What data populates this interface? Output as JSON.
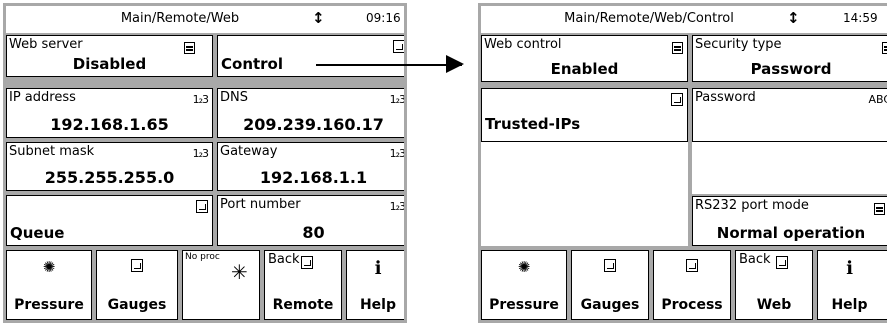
{
  "left_screen": {
    "title": "Main/Remote/Web",
    "arrow": "↕",
    "time": "09:16",
    "cells": {
      "web_server": {
        "label": "Web server",
        "value": "Disabled"
      },
      "control": {
        "value": "Control"
      },
      "ip_address": {
        "label": "IP address",
        "value": "192.168.1.65",
        "icon_text": "1₂3"
      },
      "dns": {
        "label": "DNS",
        "value": "209.239.160.17",
        "icon_text": "1₂3"
      },
      "subnet_mask": {
        "label": "Subnet mask",
        "value": "255.255.255.0",
        "icon_text": "1₂3"
      },
      "gateway": {
        "label": "Gateway",
        "value": "192.168.1.1",
        "icon_text": "1₂3"
      },
      "queue": {
        "value": "Queue"
      },
      "port_number": {
        "label": "Port number",
        "value": "80",
        "icon_text": "1₂3"
      }
    },
    "buttons": {
      "pressure": {
        "label": "Pressure",
        "icon": "pressure-icon"
      },
      "gauges": {
        "label": "Gauges",
        "icon": "gauges-icon"
      },
      "noproc": {
        "label": "No proc",
        "icon": "asterisk-icon"
      },
      "remote": {
        "back": "Back",
        "label": "Remote",
        "icon": "back-icon"
      },
      "help": {
        "label": "Help",
        "icon": "info-icon"
      }
    }
  },
  "right_screen": {
    "title": "Main/Remote/Web/Control",
    "arrow": "↕",
    "time": "14:59",
    "cells": {
      "web_control": {
        "label": "Web control",
        "value": "Enabled"
      },
      "security_type": {
        "label": "Security type",
        "value": "Password"
      },
      "trusted_ips": {
        "value": "Trusted-IPs"
      },
      "password": {
        "label": "Password",
        "icon_text": "ABC"
      },
      "rs232": {
        "label": "RS232 port mode",
        "value": "Normal operation"
      }
    },
    "buttons": {
      "pressure": {
        "label": "Pressure",
        "icon": "pressure-icon"
      },
      "gauges": {
        "label": "Gauges",
        "icon": "gauges-icon"
      },
      "process": {
        "label": "Process",
        "icon": "process-icon"
      },
      "web": {
        "back": "Back",
        "label": "Web",
        "icon": "back-icon"
      },
      "help": {
        "label": "Help",
        "icon": "info-icon"
      }
    }
  },
  "colors": {
    "frame": "#a8a8a8",
    "cell_bg": "#ffffff",
    "text": "#000000"
  }
}
